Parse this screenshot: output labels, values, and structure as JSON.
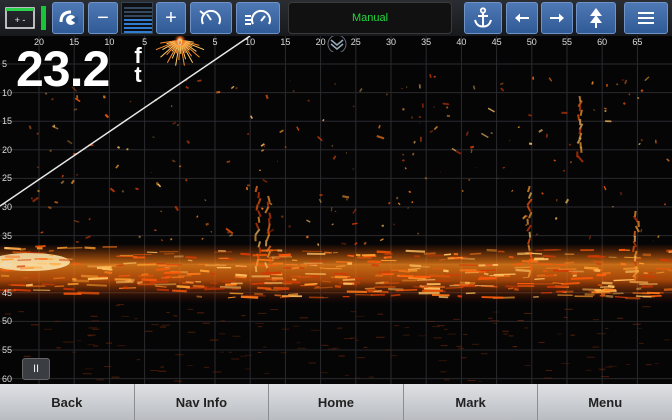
{
  "toolbar": {
    "battery_icon": "battery-icon",
    "display_icon": "sonar-view-icon",
    "zoom_out_label": "−",
    "zoom_in_label": "+",
    "range_icon": "range-gauge-icon",
    "sensitivity_icon": "sensitivity-gauge-icon",
    "mode_label": "Manual",
    "anchor_icon": "anchor-icon",
    "left_icon": "arrow-left-icon",
    "right_icon": "arrow-right-icon",
    "up_icon": "arrow-up-icon",
    "menu_icon": "hamburger-menu-icon",
    "battery_color": "#19c33a",
    "mode_color": "#22d83d",
    "button_color": "#3f6ca8"
  },
  "sonar": {
    "depth_value": "23.2",
    "depth_unit_top": "f",
    "depth_unit_bottom": "t",
    "x_ticks": [
      "20",
      "15",
      "10",
      "5",
      "0",
      "5",
      "10",
      "15",
      "20",
      "25",
      "30",
      "35",
      "40",
      "45",
      "50",
      "55",
      "60",
      "65"
    ],
    "y_ticks": [
      "5",
      "10",
      "15",
      "20",
      "25",
      "30",
      "35",
      "40",
      "45",
      "50",
      "55",
      "60"
    ],
    "pause_label": "II"
  },
  "bottom_bar": {
    "back_label": "Back",
    "nav_info_label": "Nav Info",
    "home_label": "Home",
    "mark_label": "Mark",
    "menu_label": "Menu"
  }
}
